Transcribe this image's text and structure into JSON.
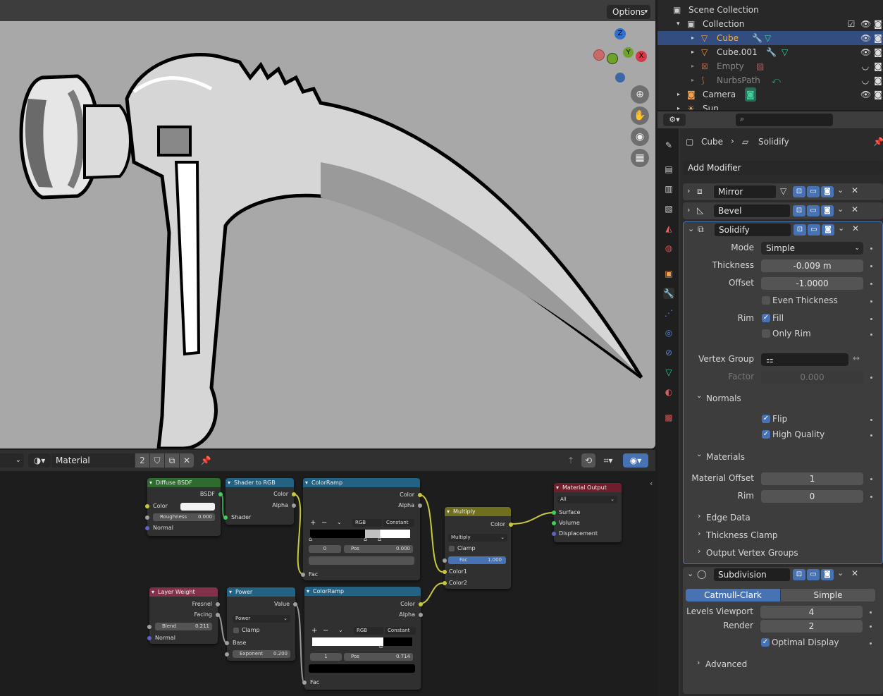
{
  "viewport": {
    "options_label": "Options",
    "gizmo": {
      "z": "Z",
      "y": "Y",
      "x": "X"
    }
  },
  "outliner": {
    "root": "Scene Collection",
    "items": [
      {
        "label": "Collection"
      },
      {
        "label": "Cube",
        "selected": true
      },
      {
        "label": "Cube.001"
      },
      {
        "label": "Empty"
      },
      {
        "label": "NurbsPath"
      },
      {
        "label": "Camera"
      },
      {
        "label": "Sun"
      }
    ]
  },
  "properties": {
    "search_placeholder": "",
    "breadcrumb": {
      "object": "Cube",
      "modifier": "Solidify"
    },
    "add_modifier": "Add Modifier",
    "modifiers": {
      "mirror": "Mirror",
      "bevel": "Bevel",
      "solidify": "Solidify",
      "subdivision": "Subdivision"
    },
    "solidify": {
      "mode_label": "Mode",
      "mode_value": "Simple",
      "thickness_label": "Thickness",
      "thickness_value": "-0.009 m",
      "offset_label": "Offset",
      "offset_value": "-1.0000",
      "even_thickness": "Even Thickness",
      "rim_label": "Rim",
      "fill": "Fill",
      "only_rim": "Only Rim",
      "vertex_group_label": "Vertex Group",
      "factor_label": "Factor",
      "factor_value": "0.000",
      "normals": "Normals",
      "flip": "Flip",
      "high_quality": "High Quality",
      "materials": "Materials",
      "material_offset_label": "Material Offset",
      "material_offset_value": "1",
      "rim_mat_label": "Rim",
      "rim_mat_value": "0",
      "edge_data": "Edge Data",
      "thickness_clamp": "Thickness Clamp",
      "output_vertex_groups": "Output Vertex Groups"
    },
    "subdivision": {
      "catmull": "Catmull-Clark",
      "simple": "Simple",
      "levels_label": "Levels Viewport",
      "levels_value": "4",
      "render_label": "Render",
      "render_value": "2",
      "optimal": "Optimal Display",
      "advanced": "Advanced"
    }
  },
  "node_editor": {
    "material_name": "Material",
    "users": "2",
    "nodes": {
      "diffuse": {
        "title": "Diffuse BSDF",
        "out": "BSDF",
        "color": "Color",
        "roughness": "Roughness",
        "roughness_value": "0.000",
        "normal": "Normal"
      },
      "shader_rgb": {
        "title": "Shader to RGB",
        "color": "Color",
        "alpha": "Alpha",
        "shader": "Shader"
      },
      "ramp1": {
        "title": "ColorRamp",
        "color": "Color",
        "alpha": "Alpha",
        "mode": "RGB",
        "interp": "Constant",
        "index": "0",
        "pos_label": "Pos",
        "pos_value": "0.000",
        "fac": "Fac"
      },
      "multiply": {
        "title": "Multiply",
        "color": "Color",
        "blend": "Multiply",
        "clamp": "Clamp",
        "fac": "Fac",
        "fac_value": "1.000",
        "color1": "Color1",
        "color2": "Color2"
      },
      "output": {
        "title": "Material Output",
        "target": "All",
        "surface": "Surface",
        "volume": "Volume",
        "displacement": "Displacement"
      },
      "layer_weight": {
        "title": "Layer Weight",
        "fresnel": "Fresnel",
        "facing": "Facing",
        "blend": "Blend",
        "blend_value": "0.211",
        "normal": "Normal"
      },
      "power": {
        "title": "Power",
        "value": "Value",
        "op": "Power",
        "clamp": "Clamp",
        "base": "Base",
        "exponent": "Exponent",
        "exponent_value": "0.200"
      },
      "ramp2": {
        "title": "ColorRamp",
        "color": "Color",
        "alpha": "Alpha",
        "mode": "RGB",
        "interp": "Constant",
        "index": "1",
        "pos_label": "Pos",
        "pos_value": "0.714",
        "fac": "Fac"
      }
    }
  },
  "colors": {
    "accent": "#4772b3",
    "selected_row": "#334d80",
    "shader_header": "#2f6a2f",
    "converter_header": "#246283",
    "mix_header": "#6f6f1e",
    "output_header": "#6e1e2c",
    "input_header": "#83314a"
  }
}
